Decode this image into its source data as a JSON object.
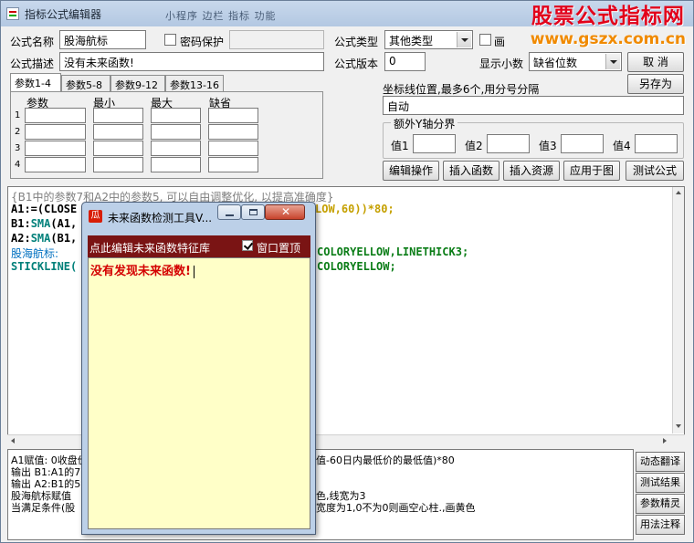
{
  "window": {
    "title": "指标公式编辑器",
    "bg_tabs": "小程序   边栏   指标   功能",
    "brand_title": "股票公式指标网",
    "brand_url": "www.gszx.com.cn"
  },
  "form": {
    "name_label": "公式名称",
    "name_value": "股海航标",
    "password_label": "密码保护",
    "type_label": "公式类型",
    "type_value": "其他类型",
    "draw_label": "画",
    "desc_label": "公式描述",
    "desc_value": "没有未来函数!",
    "version_label": "公式版本",
    "version_value": "0",
    "decimal_label": "显示小数",
    "decimal_value": "缺省位数",
    "cancel_button": "取  消",
    "saveas_button": "另存为"
  },
  "param_tabs": [
    "参数1-4",
    "参数5-8",
    "参数9-12",
    "参数13-16"
  ],
  "param_headers": [
    "参数",
    "最小",
    "最大",
    "缺省"
  ],
  "param_rows": [
    "1",
    "2",
    "3",
    "4"
  ],
  "axis": {
    "label": "坐标线位置,最多6个,用分号分隔",
    "value": "自动",
    "group_title": "额外Y轴分界",
    "v1": "值1",
    "v2": "值2",
    "v3": "值3",
    "v4": "值4"
  },
  "actions": [
    "编辑操作",
    "插入函数",
    "插入资源",
    "应用于图",
    "测试公式"
  ],
  "editor": {
    "line1": "{B1中的参数7和A2中的参数5, 可以自由调整优化, 以提高准确度}",
    "line2a": "A1:=(CLOSE",
    "line2b": "LOW,60))*80;",
    "line3a": "B1:",
    "line3b": "SMA",
    "line3c": "(A1,",
    "line4a": "A2:",
    "line4b": "SMA",
    "line4c": "(B1,",
    "line5a": "股海航标:",
    "line5b": "COLORYELLOW,LINETHICK3;",
    "line6a": "STICKLINE(",
    "line6b": "COLORYELLOW;"
  },
  "explain": {
    "l1": "A1赋值: 0收盘价",
    "r1": "值-60日内最低价的最低值)*80",
    "l2": "输出 B1:A1的7",
    "l3": "输出 A2:B1的5",
    "l4": "股海航标赋值",
    "r4": "色,线宽为3",
    "l5": "当满足条件(股",
    "r5": "宽度为1,0不为0则画空心柱.,画黄色"
  },
  "side_buttons": [
    "动态翻译",
    "测试结果",
    "参数精灵",
    "用法注释"
  ],
  "dialog": {
    "title": "未来函数检测工具V...",
    "icon": "瓜",
    "header": "点此编辑未来函数特征库",
    "topmost_label": "窗口置顶",
    "topmost_checked": true,
    "message": "没有发现未来函数!"
  }
}
